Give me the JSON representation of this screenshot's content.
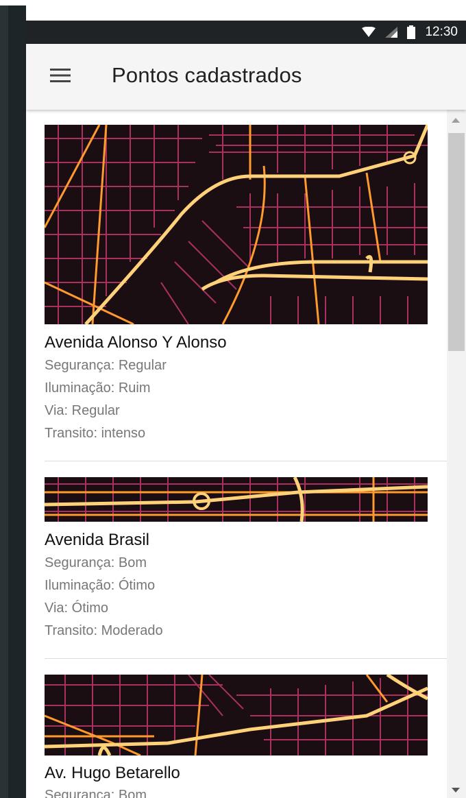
{
  "status_bar": {
    "time": "12:30"
  },
  "app_bar": {
    "title": "Pontos cadastrados",
    "menu_icon": "hamburger-menu-icon"
  },
  "points": [
    {
      "name": "Avenida Alonso Y Alonso",
      "lines": [
        "Segurança: Regular",
        "Iluminação: Ruim",
        "Via: Regular",
        "Transito: intenso"
      ]
    },
    {
      "name": "Avenida Brasil",
      "lines": [
        "Segurança: Bom",
        "Iluminação: Ótimo",
        "Via: Ótimo",
        "Transito: Moderado"
      ]
    },
    {
      "name": "Av. Hugo Betarello",
      "lines": [
        "Segurança: Bom"
      ]
    }
  ],
  "colors": {
    "map_background": "#1b0e12",
    "road_major": "#ffd27a",
    "road_arterial": "#ff9a2e",
    "road_minor": "#c4376d",
    "app_bar": "#f5f5f5",
    "status_bar": "#1f2326"
  }
}
